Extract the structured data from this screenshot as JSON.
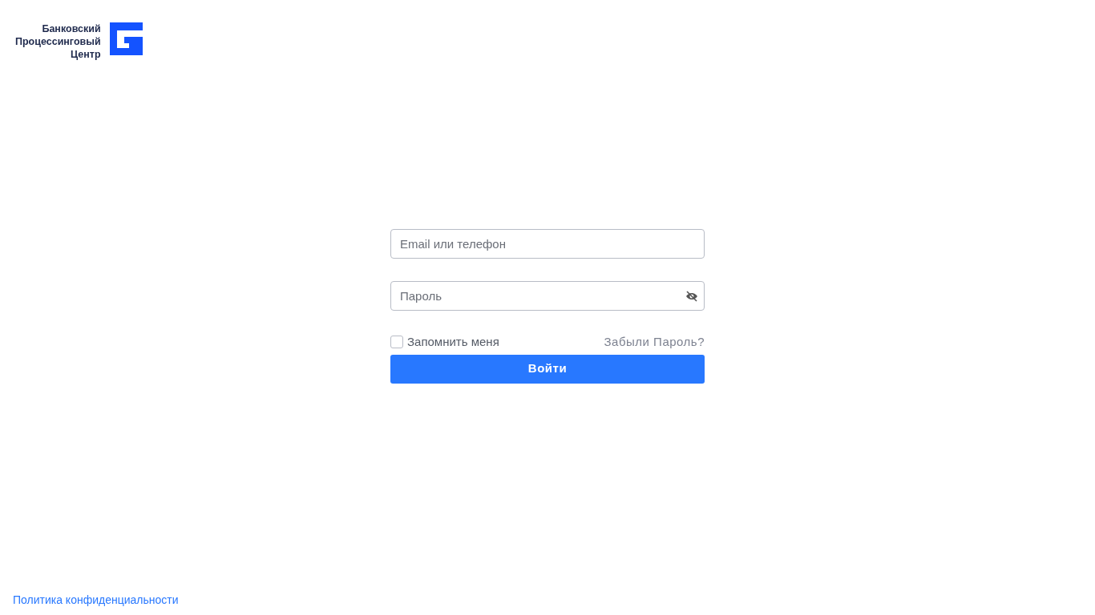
{
  "logo": {
    "lines": [
      "Банковский",
      "Процессинговый",
      "Центр"
    ]
  },
  "login_form": {
    "email": {
      "placeholder": "Email или телефон"
    },
    "password": {
      "placeholder": "Пароль"
    },
    "remember": {
      "label": "Запомнить меня",
      "checked": false
    },
    "forgot_link": "Забыли Пароль?",
    "submit": "Войти"
  },
  "footer": {
    "privacy_link": "Политика конфиденциальности"
  }
}
